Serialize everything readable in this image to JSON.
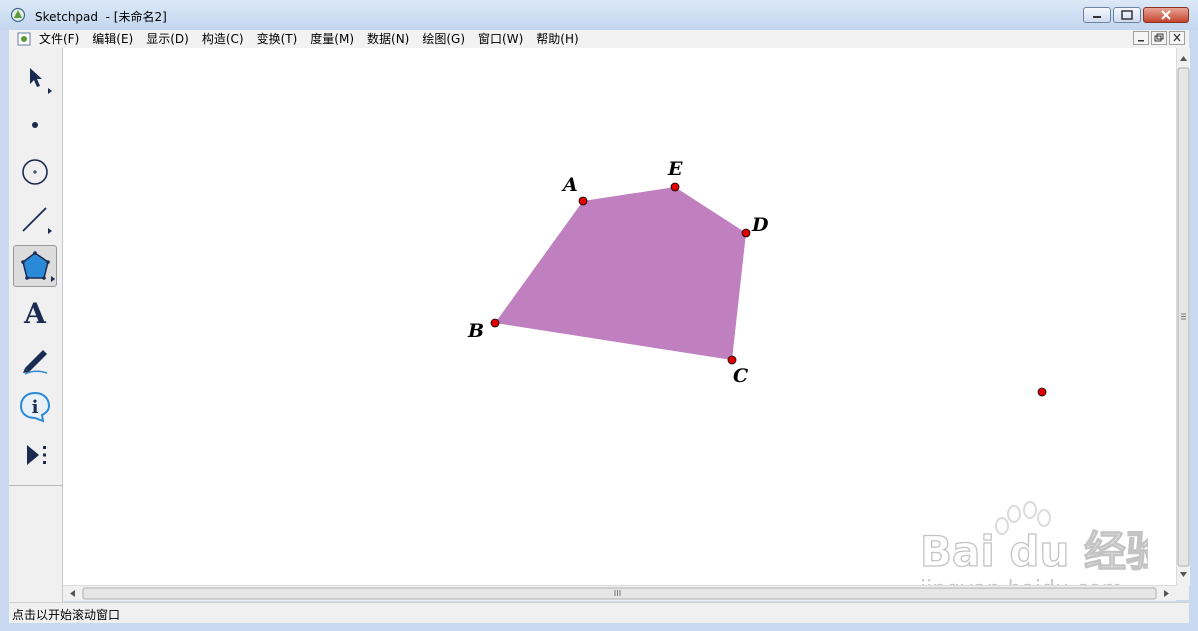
{
  "window": {
    "title": "Sketchpad  - [未命名2]"
  },
  "menu": {
    "items": [
      "文件(F)",
      "编辑(E)",
      "显示(D)",
      "构造(C)",
      "变换(T)",
      "度量(M)",
      "数据(N)",
      "绘图(G)",
      "窗口(W)",
      "帮助(H)"
    ]
  },
  "toolbox": {
    "tools": [
      "select-arrow-tool",
      "point-tool",
      "compass-tool",
      "straightedge-tool",
      "polygon-tool",
      "text-tool",
      "marker-tool",
      "information-tool",
      "custom-tool"
    ],
    "active": "polygon-tool"
  },
  "canvas": {
    "polygon_color": "#c080c0",
    "point_color": "#e00000",
    "points": {
      "A": "A",
      "B": "B",
      "C": "C",
      "D": "D",
      "E": "E"
    }
  },
  "watermark": {
    "brand": "Bai du 经验",
    "url": "jingyan.baidu.com"
  },
  "status": {
    "text": "点击以开始滚动窗口"
  }
}
